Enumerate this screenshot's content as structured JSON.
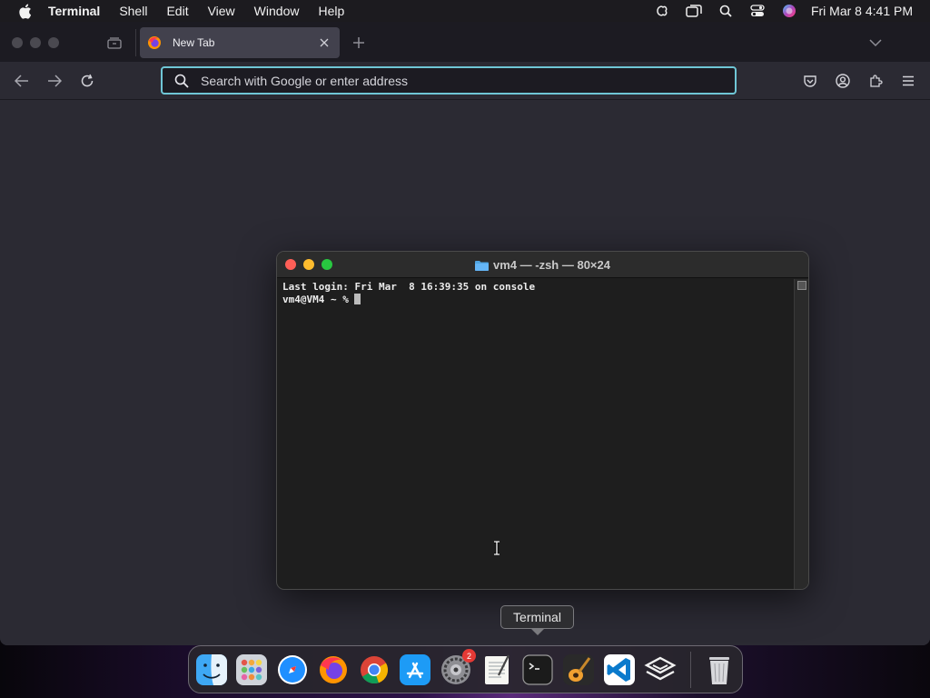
{
  "menubar": {
    "app_name": "Terminal",
    "items": [
      "Shell",
      "Edit",
      "View",
      "Window",
      "Help"
    ],
    "clock": "Fri Mar 8  4:41 PM"
  },
  "browser": {
    "tab_title": "New Tab",
    "url_placeholder": "Search with Google or enter address",
    "accent_color": "#6fc6d6"
  },
  "terminal": {
    "title": "vm4 — -zsh — 80×24",
    "lines": [
      "Last login: Fri Mar  8 16:39:35 on console",
      "vm4@VM4 ~ % "
    ]
  },
  "tooltip": "Terminal",
  "dock": {
    "items": [
      {
        "name": "finder-icon"
      },
      {
        "name": "launchpad-icon"
      },
      {
        "name": "safari-icon"
      },
      {
        "name": "firefox-icon"
      },
      {
        "name": "chrome-icon"
      },
      {
        "name": "app-store-icon"
      },
      {
        "name": "system-settings-icon",
        "badge": "2"
      },
      {
        "name": "textedit-icon"
      },
      {
        "name": "terminal-icon"
      },
      {
        "name": "garageband-icon"
      },
      {
        "name": "vscode-icon"
      },
      {
        "name": "unknown-app-icon"
      },
      {
        "name": "trash-icon"
      }
    ]
  }
}
